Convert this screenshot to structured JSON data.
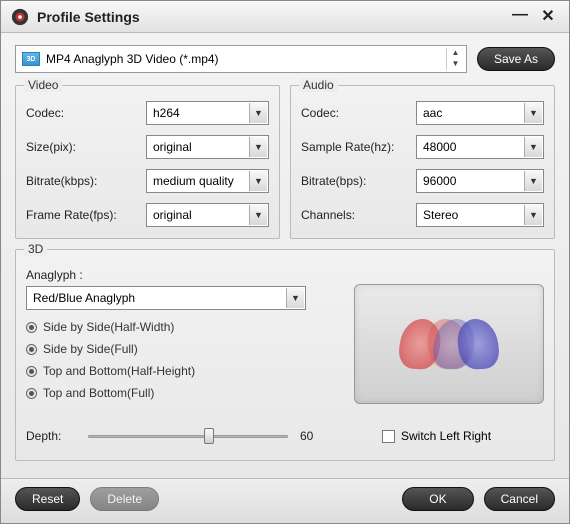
{
  "window": {
    "title": "Profile Settings"
  },
  "top": {
    "profile": "MP4 Anaglyph 3D Video (*.mp4)",
    "cube_label": "3D",
    "save_as": "Save As"
  },
  "video": {
    "legend": "Video",
    "codec_label": "Codec:",
    "codec_value": "h264",
    "size_label": "Size(pix):",
    "size_value": "original",
    "bitrate_label": "Bitrate(kbps):",
    "bitrate_value": "medium quality",
    "framerate_label": "Frame Rate(fps):",
    "framerate_value": "original"
  },
  "audio": {
    "legend": "Audio",
    "codec_label": "Codec:",
    "codec_value": "aac",
    "samplerate_label": "Sample Rate(hz):",
    "samplerate_value": "48000",
    "bitrate_label": "Bitrate(bps):",
    "bitrate_value": "96000",
    "channels_label": "Channels:",
    "channels_value": "Stereo"
  },
  "threeD": {
    "legend": "3D",
    "anaglyph_label": "Anaglyph :",
    "anaglyph_value": "Red/Blue Anaglyph",
    "options": {
      "sbs_half": "Side by Side(Half-Width)",
      "sbs_full": "Side by Side(Full)",
      "tab_half": "Top and Bottom(Half-Height)",
      "tab_full": "Top and Bottom(Full)"
    },
    "depth_label": "Depth:",
    "depth_value": "60",
    "switch_label": "Switch Left Right"
  },
  "footer": {
    "reset": "Reset",
    "delete": "Delete",
    "ok": "OK",
    "cancel": "Cancel"
  },
  "chart_data": null
}
